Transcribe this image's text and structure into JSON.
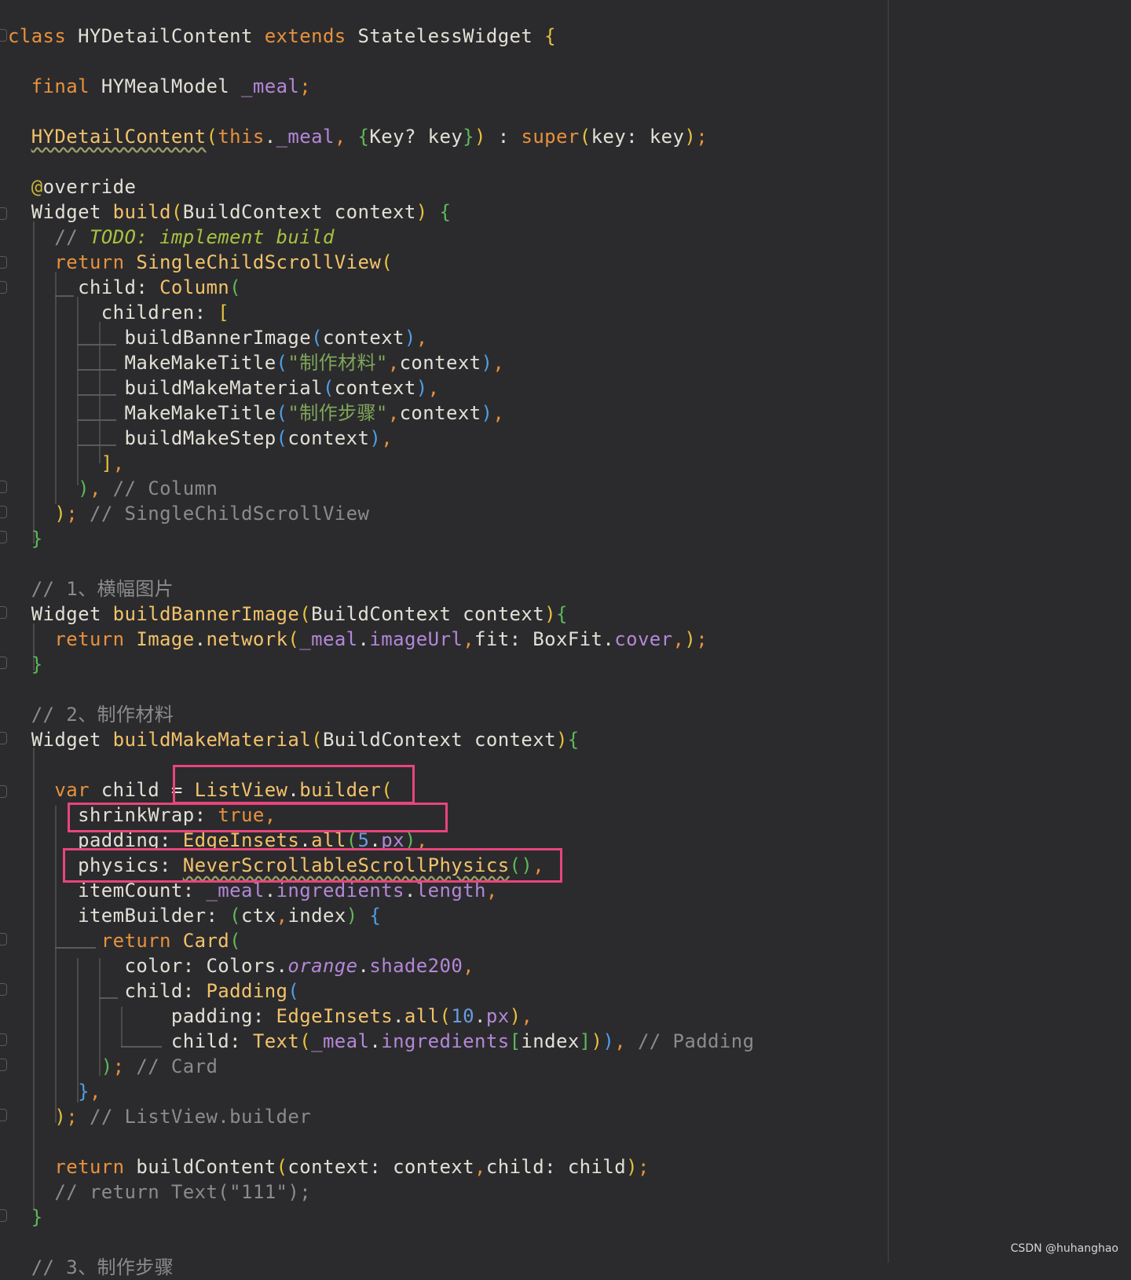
{
  "code": {
    "lines": [
      {
        "t": [
          [
            "kw",
            "class "
          ],
          [
            "ty",
            "HYDetailContent "
          ],
          [
            "kw",
            "extends "
          ],
          [
            "ty",
            "StatelessWidget "
          ],
          [
            "b1",
            "{"
          ]
        ]
      },
      {
        "t": []
      },
      {
        "t": [
          [
            "sp",
            "  "
          ],
          [
            "kw",
            "final "
          ],
          [
            "ty",
            "HYMealModel "
          ],
          [
            "fld",
            "_meal"
          ],
          [
            "pun",
            ";"
          ]
        ]
      },
      {
        "t": []
      },
      {
        "t": [
          [
            "sp",
            "  "
          ],
          [
            "fnw",
            "HYDetailContent"
          ],
          [
            "b1",
            "("
          ],
          [
            "kw",
            "this"
          ],
          [
            "ty",
            "."
          ],
          [
            "fld",
            "_meal"
          ],
          [
            "pun",
            ", "
          ],
          [
            "b2",
            "{"
          ],
          [
            "ty",
            "Key? key"
          ],
          [
            "b2",
            "}"
          ],
          [
            "b1",
            ")"
          ],
          [
            "ty",
            " : "
          ],
          [
            "kw",
            "super"
          ],
          [
            "b1",
            "("
          ],
          [
            "ty",
            "key: key"
          ],
          [
            "b1",
            ")"
          ],
          [
            "pun",
            ";"
          ]
        ]
      },
      {
        "t": []
      },
      {
        "t": [
          [
            "sp",
            "  "
          ],
          [
            "ann",
            "@"
          ],
          [
            "ty",
            "override"
          ]
        ]
      },
      {
        "t": [
          [
            "sp",
            "  "
          ],
          [
            "ty",
            "Widget "
          ],
          [
            "fn",
            "build"
          ],
          [
            "b1",
            "("
          ],
          [
            "ty",
            "BuildContext context"
          ],
          [
            "b1",
            ")"
          ],
          [
            "ty",
            " "
          ],
          [
            "b2",
            "{"
          ]
        ]
      },
      {
        "t": [
          [
            "sp",
            "    "
          ],
          [
            "cmt",
            "// "
          ],
          [
            "todo",
            "TODO: implement build"
          ]
        ]
      },
      {
        "t": [
          [
            "sp",
            "    "
          ],
          [
            "kw",
            "return "
          ],
          [
            "fn",
            "SingleChildScrollView"
          ],
          [
            "b1",
            "("
          ]
        ]
      },
      {
        "t": [
          [
            "sp",
            "      "
          ],
          [
            "ty",
            "child: "
          ],
          [
            "fn",
            "Column"
          ],
          [
            "b2",
            "("
          ]
        ]
      },
      {
        "t": [
          [
            "sp",
            "        "
          ],
          [
            "ty",
            "children: "
          ],
          [
            "b1",
            "["
          ]
        ]
      },
      {
        "t": [
          [
            "sp",
            "          "
          ],
          [
            "ty",
            "buildBannerImage"
          ],
          [
            "b3",
            "("
          ],
          [
            "ty",
            "context"
          ],
          [
            "b3",
            ")"
          ],
          [
            "pun",
            ","
          ]
        ]
      },
      {
        "t": [
          [
            "sp",
            "          "
          ],
          [
            "ty",
            "MakeMakeTitle"
          ],
          [
            "b3",
            "("
          ],
          [
            "str",
            "\"制作材料\""
          ],
          [
            "pun",
            ","
          ],
          [
            "ty",
            "context"
          ],
          [
            "b3",
            ")"
          ],
          [
            "pun",
            ","
          ]
        ]
      },
      {
        "t": [
          [
            "sp",
            "          "
          ],
          [
            "ty",
            "buildMakeMaterial"
          ],
          [
            "b3",
            "("
          ],
          [
            "ty",
            "context"
          ],
          [
            "b3",
            ")"
          ],
          [
            "pun",
            ","
          ]
        ]
      },
      {
        "t": [
          [
            "sp",
            "          "
          ],
          [
            "ty",
            "MakeMakeTitle"
          ],
          [
            "b3",
            "("
          ],
          [
            "str",
            "\"制作步骤\""
          ],
          [
            "pun",
            ","
          ],
          [
            "ty",
            "context"
          ],
          [
            "b3",
            ")"
          ],
          [
            "pun",
            ","
          ]
        ]
      },
      {
        "t": [
          [
            "sp",
            "          "
          ],
          [
            "ty",
            "buildMakeStep"
          ],
          [
            "b3",
            "("
          ],
          [
            "ty",
            "context"
          ],
          [
            "b3",
            ")"
          ],
          [
            "pun",
            ","
          ]
        ]
      },
      {
        "t": [
          [
            "sp",
            "        "
          ],
          [
            "b1",
            "]"
          ],
          [
            "pun",
            ","
          ]
        ]
      },
      {
        "t": [
          [
            "sp",
            "      "
          ],
          [
            "b2",
            ")"
          ],
          [
            "pun",
            ", "
          ],
          [
            "cmt",
            "// Column"
          ]
        ]
      },
      {
        "t": [
          [
            "sp",
            "    "
          ],
          [
            "b1",
            ")"
          ],
          [
            "pun",
            "; "
          ],
          [
            "cmt",
            "// SingleChildScrollView"
          ]
        ]
      },
      {
        "t": [
          [
            "sp",
            "  "
          ],
          [
            "b2",
            "}"
          ]
        ]
      },
      {
        "t": []
      },
      {
        "t": [
          [
            "sp",
            "  "
          ],
          [
            "cmt",
            "// 1、横幅图片"
          ]
        ]
      },
      {
        "t": [
          [
            "sp",
            "  "
          ],
          [
            "ty",
            "Widget "
          ],
          [
            "fn",
            "buildBannerImage"
          ],
          [
            "b1",
            "("
          ],
          [
            "ty",
            "BuildContext context"
          ],
          [
            "b1",
            ")"
          ],
          [
            "b2",
            "{"
          ]
        ]
      },
      {
        "t": [
          [
            "sp",
            "    "
          ],
          [
            "kw",
            "return "
          ],
          [
            "fn",
            "Image"
          ],
          [
            "ty",
            "."
          ],
          [
            "fn",
            "network"
          ],
          [
            "b1",
            "("
          ],
          [
            "fld",
            "_meal"
          ],
          [
            "ty",
            "."
          ],
          [
            "fld",
            "imageUrl"
          ],
          [
            "pun",
            ","
          ],
          [
            "ty",
            "fit: "
          ],
          [
            "ty",
            "BoxFit."
          ],
          [
            "fld",
            "cover"
          ],
          [
            "pun",
            ","
          ],
          [
            "b1",
            ")"
          ],
          [
            "pun",
            ";"
          ]
        ]
      },
      {
        "t": [
          [
            "sp",
            "  "
          ],
          [
            "b2",
            "}"
          ]
        ]
      },
      {
        "t": []
      },
      {
        "t": [
          [
            "sp",
            "  "
          ],
          [
            "cmt",
            "// 2、制作材料"
          ]
        ]
      },
      {
        "t": [
          [
            "sp",
            "  "
          ],
          [
            "ty",
            "Widget "
          ],
          [
            "fn",
            "buildMakeMaterial"
          ],
          [
            "b1",
            "("
          ],
          [
            "ty",
            "BuildContext context"
          ],
          [
            "b1",
            ")"
          ],
          [
            "b2",
            "{"
          ]
        ]
      },
      {
        "t": []
      },
      {
        "t": [
          [
            "sp",
            "    "
          ],
          [
            "kw",
            "var "
          ],
          [
            "ty",
            "child = "
          ],
          [
            "fn",
            "ListView"
          ],
          [
            "ty",
            "."
          ],
          [
            "fn",
            "builder"
          ],
          [
            "b1",
            "("
          ]
        ]
      },
      {
        "t": [
          [
            "sp",
            "      "
          ],
          [
            "ty",
            "shrinkWrap: "
          ],
          [
            "kw",
            "true"
          ],
          [
            "pun",
            ","
          ]
        ]
      },
      {
        "t": [
          [
            "sp",
            "      "
          ],
          [
            "ty",
            "padding: "
          ],
          [
            "fn",
            "EdgeInsets"
          ],
          [
            "ty",
            "."
          ],
          [
            "fn",
            "all"
          ],
          [
            "b2",
            "("
          ],
          [
            "num",
            "5"
          ],
          [
            "ty",
            "."
          ],
          [
            "fld",
            "px"
          ],
          [
            "b2",
            ")"
          ],
          [
            "pun",
            ","
          ]
        ]
      },
      {
        "t": [
          [
            "sp",
            "      "
          ],
          [
            "ty",
            "physics: "
          ],
          [
            "fnw",
            "NeverScrollableScrollPhysics"
          ],
          [
            "b2",
            "()"
          ],
          [
            "pun",
            ","
          ]
        ]
      },
      {
        "t": [
          [
            "sp",
            "      "
          ],
          [
            "ty",
            "itemCount: "
          ],
          [
            "fld",
            "_meal"
          ],
          [
            "ty",
            "."
          ],
          [
            "fld",
            "ingredients"
          ],
          [
            "ty",
            "."
          ],
          [
            "fld",
            "length"
          ],
          [
            "pun",
            ","
          ]
        ]
      },
      {
        "t": [
          [
            "sp",
            "      "
          ],
          [
            "ty",
            "itemBuilder: "
          ],
          [
            "b2",
            "("
          ],
          [
            "ty",
            "ctx"
          ],
          [
            "pun",
            ","
          ],
          [
            "ty",
            "index"
          ],
          [
            "b2",
            ")"
          ],
          [
            "ty",
            " "
          ],
          [
            "b3",
            "{"
          ]
        ]
      },
      {
        "t": [
          [
            "sp",
            "        "
          ],
          [
            "kw",
            "return "
          ],
          [
            "fn",
            "Card"
          ],
          [
            "b2",
            "("
          ]
        ]
      },
      {
        "t": [
          [
            "sp",
            "          "
          ],
          [
            "ty",
            "color: "
          ],
          [
            "ty",
            "Colors."
          ],
          [
            "ital",
            "orange"
          ],
          [
            "ty",
            "."
          ],
          [
            "fld",
            "shade200"
          ],
          [
            "pun",
            ","
          ]
        ]
      },
      {
        "t": [
          [
            "sp",
            "          "
          ],
          [
            "ty",
            "child: "
          ],
          [
            "fn",
            "Padding"
          ],
          [
            "b3",
            "("
          ]
        ]
      },
      {
        "t": [
          [
            "sp",
            "              "
          ],
          [
            "ty",
            "padding: "
          ],
          [
            "fn",
            "EdgeInsets"
          ],
          [
            "ty",
            "."
          ],
          [
            "fn",
            "all"
          ],
          [
            "b1",
            "("
          ],
          [
            "num",
            "10"
          ],
          [
            "ty",
            "."
          ],
          [
            "fld",
            "px"
          ],
          [
            "b1",
            ")"
          ],
          [
            "pun",
            ","
          ]
        ]
      },
      {
        "t": [
          [
            "sp",
            "              "
          ],
          [
            "ty",
            "child: "
          ],
          [
            "fn",
            "Text"
          ],
          [
            "b1",
            "("
          ],
          [
            "fld",
            "_meal"
          ],
          [
            "ty",
            "."
          ],
          [
            "fld",
            "ingredients"
          ],
          [
            "b2",
            "["
          ],
          [
            "ty",
            "index"
          ],
          [
            "b2",
            "]"
          ],
          [
            "b1",
            ")"
          ],
          [
            "b3",
            ")"
          ],
          [
            "pun",
            ", "
          ],
          [
            "cmt",
            "// Padding"
          ]
        ]
      },
      {
        "t": [
          [
            "sp",
            "        "
          ],
          [
            "b2",
            ")"
          ],
          [
            "pun",
            "; "
          ],
          [
            "cmt",
            "// Card"
          ]
        ]
      },
      {
        "t": [
          [
            "sp",
            "      "
          ],
          [
            "b3",
            "}"
          ],
          [
            "pun",
            ","
          ]
        ]
      },
      {
        "t": [
          [
            "sp",
            "    "
          ],
          [
            "b1",
            ")"
          ],
          [
            "pun",
            "; "
          ],
          [
            "cmt",
            "// ListView.builder"
          ]
        ]
      },
      {
        "t": []
      },
      {
        "t": [
          [
            "sp",
            "    "
          ],
          [
            "kw",
            "return "
          ],
          [
            "ty",
            "buildContent"
          ],
          [
            "b1",
            "("
          ],
          [
            "ty",
            "context: context"
          ],
          [
            "pun",
            ","
          ],
          [
            "ty",
            "child: child"
          ],
          [
            "b1",
            ")"
          ],
          [
            "pun",
            ";"
          ]
        ]
      },
      {
        "t": [
          [
            "sp",
            "    "
          ],
          [
            "cmt",
            "// return Text(\"111\");"
          ]
        ]
      },
      {
        "t": [
          [
            "sp",
            "  "
          ],
          [
            "b2",
            "}"
          ]
        ]
      },
      {
        "t": []
      },
      {
        "t": [
          [
            "sp",
            "  "
          ],
          [
            "cmt",
            "// 3、制作步骤"
          ]
        ]
      }
    ]
  },
  "watermark": "CSDN @huhanghao"
}
